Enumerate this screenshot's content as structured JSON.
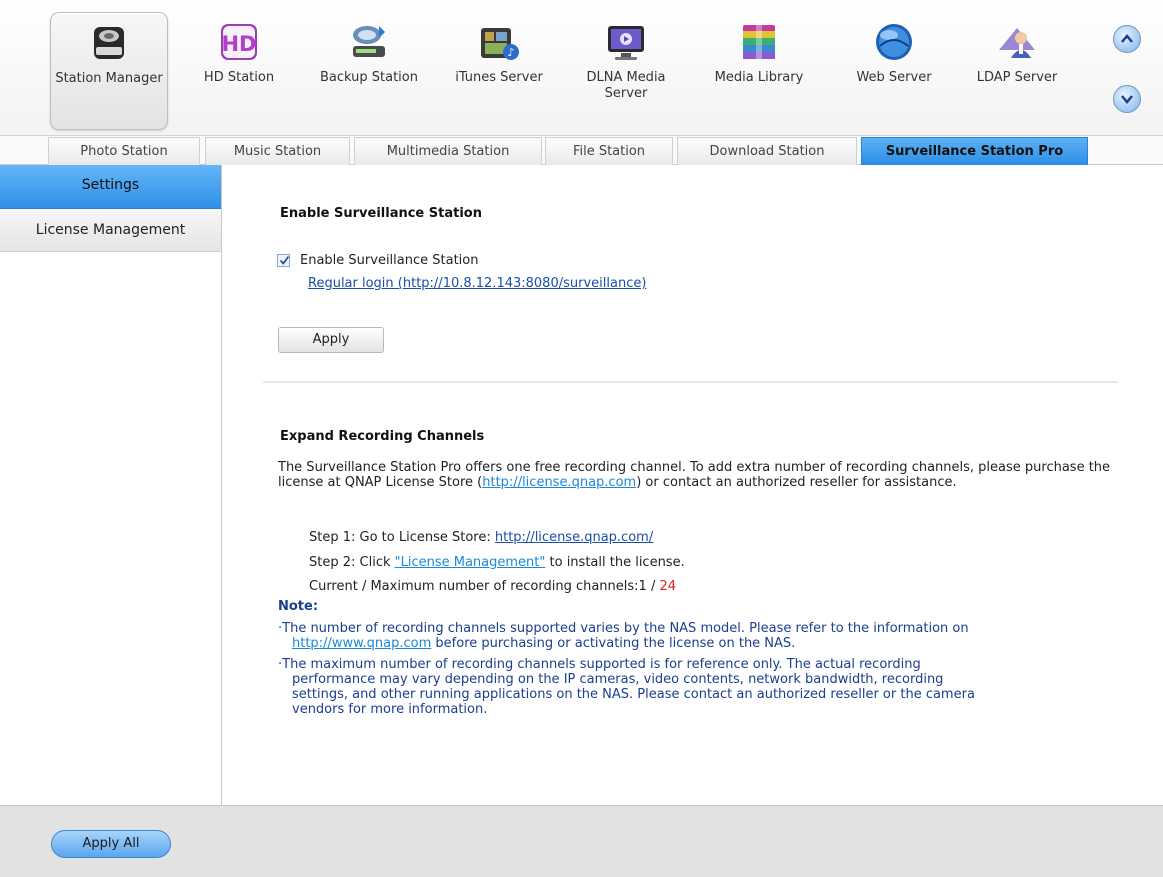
{
  "apps": [
    {
      "label": "Station Manager",
      "icon": "station-manager-icon"
    },
    {
      "label": "HD Station",
      "icon": "hd-station-icon"
    },
    {
      "label": "Backup Station",
      "icon": "backup-station-icon"
    },
    {
      "label": "iTunes Server",
      "icon": "itunes-server-icon"
    },
    {
      "label": "DLNA Media Server",
      "icon": "dlna-media-server-icon"
    },
    {
      "label": "Media Library",
      "icon": "media-library-icon"
    },
    {
      "label": "Web Server",
      "icon": "web-server-icon"
    },
    {
      "label": "LDAP Server",
      "icon": "ldap-server-icon"
    }
  ],
  "tabs": [
    {
      "label": "Photo Station"
    },
    {
      "label": "Music Station"
    },
    {
      "label": "Multimedia Station"
    },
    {
      "label": "File Station"
    },
    {
      "label": "Download Station"
    },
    {
      "label": "Surveillance Station Pro",
      "active": true
    }
  ],
  "sidebar": {
    "items": [
      {
        "label": "Settings",
        "active": true
      },
      {
        "label": "License Management"
      }
    ]
  },
  "enable_section": {
    "title": "Enable Surveillance Station",
    "checkbox_label": "Enable Surveillance Station",
    "checked": true,
    "login_link": "Regular login (http://10.8.12.143:8080/surveillance)",
    "apply_label": "Apply"
  },
  "expand_section": {
    "title": "Expand Recording Channels",
    "para_before": "The Surveillance Station Pro offers one free recording channel. To add extra number of recording channels, please purchase the license at QNAP License Store (",
    "para_link": "http://license.qnap.com",
    "para_after": ") or contact an authorized reseller for assistance.",
    "step1_text": "Step 1: Go to License Store: ",
    "step1_link": "http://license.qnap.com/",
    "step2_before": "Step 2: Click ",
    "step2_link": "\"License Management\"",
    "step2_after": " to install the license.",
    "channels_text": "Current / Maximum number of recording channels:",
    "current_channels": "1",
    "separator": " / ",
    "max_channels": "24",
    "note_title": "Note:",
    "note1_a": "·The number of recording channels supported varies by the NAS model. Please refer to the information on",
    "note1_link": "http://www.qnap.com",
    "note1_b": " before purchasing or activating the license on the NAS.",
    "note2_a": "·The maximum number of recording channels supported is for reference only. The actual recording",
    "note2_b": "performance may vary depending on the IP cameras, video contents, network bandwidth, recording",
    "note2_c": "settings, and other running applications on the NAS. Please contact an authorized reseller or the camera",
    "note2_d": "vendors for more information."
  },
  "footer": {
    "apply_all_label": "Apply All"
  },
  "colors": {
    "accent": "#2d8ee6",
    "note": "#1a3f8f",
    "link": "#1a4ea8",
    "max_value": "#e02020"
  }
}
